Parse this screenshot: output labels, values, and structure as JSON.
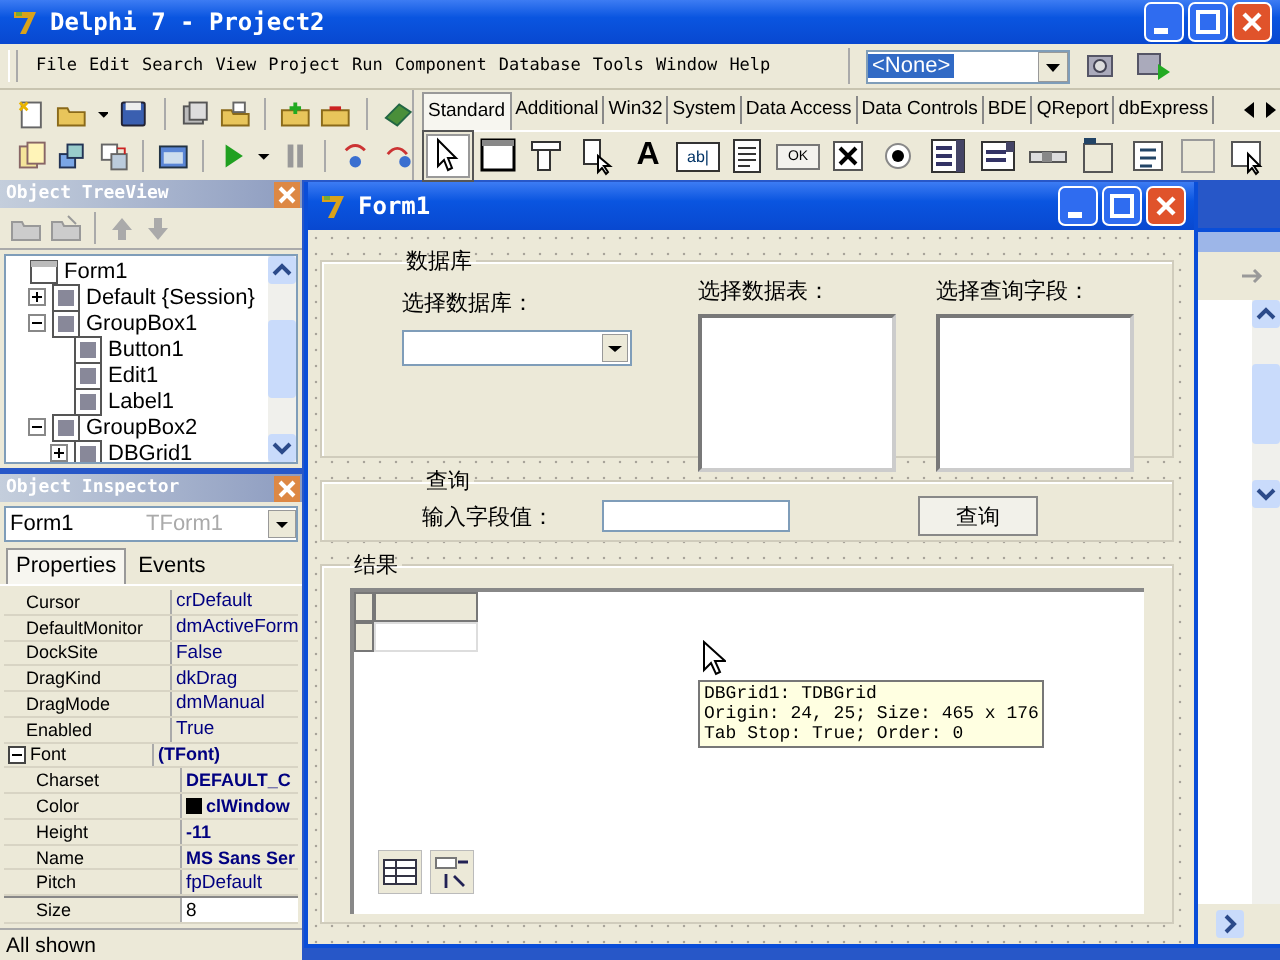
{
  "main_window": {
    "title": "Delphi 7 - Project2"
  },
  "menu": [
    "File",
    "Edit",
    "Search",
    "View",
    "Project",
    "Run",
    "Component",
    "Database",
    "Tools",
    "Window",
    "Help"
  ],
  "component_combo": {
    "value": "<None>"
  },
  "palette_tabs": [
    {
      "label": "Standard",
      "selected": true
    },
    {
      "label": "Additional",
      "selected": false
    },
    {
      "label": "Win32",
      "selected": false
    },
    {
      "label": "System",
      "selected": false
    },
    {
      "label": "Data Access",
      "selected": false
    },
    {
      "label": "Data Controls",
      "selected": false
    },
    {
      "label": "BDE",
      "selected": false
    },
    {
      "label": "QReport",
      "selected": false
    },
    {
      "label": "dbExpress",
      "selected": false
    }
  ],
  "palette_items": [
    {
      "kind": "pointer",
      "selected": true
    },
    {
      "kind": "frame",
      "selected": false
    },
    {
      "kind": "mainmenu",
      "selected": false
    },
    {
      "kind": "popupmenu",
      "selected": false
    },
    {
      "kind": "label",
      "glyph": "A",
      "selected": false
    },
    {
      "kind": "edit",
      "glyph": "ab|",
      "selected": false
    },
    {
      "kind": "memo",
      "selected": false
    },
    {
      "kind": "button",
      "glyph": "OK",
      "selected": false
    },
    {
      "kind": "checkbox",
      "selected": false
    },
    {
      "kind": "radio",
      "selected": false
    },
    {
      "kind": "listbox",
      "selected": false
    },
    {
      "kind": "combobox",
      "selected": false
    },
    {
      "kind": "scrollbar",
      "selected": false
    },
    {
      "kind": "groupbox",
      "selected": false
    },
    {
      "kind": "radiogroup",
      "selected": false
    },
    {
      "kind": "panel",
      "selected": false
    },
    {
      "kind": "actionlist",
      "selected": false
    }
  ],
  "tree_view": {
    "title": "Object TreeView",
    "items": [
      {
        "label": "Form1",
        "children": [
          {
            "label": "Default {Session}",
            "expanded": false
          },
          {
            "label": "GroupBox1",
            "expanded": true,
            "children": [
              {
                "label": "Button1"
              },
              {
                "label": "Edit1"
              },
              {
                "label": "Label1"
              }
            ]
          },
          {
            "label": "GroupBox2",
            "expanded": true,
            "children": [
              {
                "label": "DBGrid1",
                "expanded": false
              }
            ]
          }
        ]
      }
    ]
  },
  "object_inspector": {
    "title": "Object Inspector",
    "object": "Form1",
    "object_type": "TForm1",
    "tabs": [
      {
        "label": "Properties",
        "selected": true
      },
      {
        "label": "Events",
        "selected": false
      }
    ],
    "properties": [
      {
        "name": "Cursor",
        "value": "crDefault",
        "modified": false,
        "selected": false
      },
      {
        "name": "DefaultMonitor",
        "value": "dmActiveForm",
        "modified": false,
        "selected": false
      },
      {
        "name": "DockSite",
        "value": "False",
        "modified": false,
        "selected": false
      },
      {
        "name": "DragKind",
        "value": "dkDrag",
        "modified": false,
        "selected": false
      },
      {
        "name": "DragMode",
        "value": "dmManual",
        "modified": false,
        "selected": false
      },
      {
        "name": "Enabled",
        "value": "True",
        "modified": false,
        "selected": false
      },
      {
        "name": "Font",
        "value": "(TFont)",
        "modified": true,
        "selected": false,
        "expanded": true,
        "children": [
          {
            "name": "Charset",
            "value": "DEFAULT_C",
            "modified": true,
            "selected": false
          },
          {
            "name": "Color",
            "value": "clWindow",
            "modified": true,
            "selected": false,
            "color": "#000000"
          },
          {
            "name": "Height",
            "value": "-11",
            "modified": true,
            "selected": false
          },
          {
            "name": "Name",
            "value": "MS Sans Ser",
            "modified": true,
            "selected": false
          },
          {
            "name": "Pitch",
            "value": "fpDefault",
            "modified": false,
            "selected": false
          },
          {
            "name": "Size",
            "value": "8",
            "modified": false,
            "selected": true
          }
        ]
      }
    ],
    "status": "All shown"
  },
  "form": {
    "title": "Form1",
    "database_group": {
      "caption": "数据库",
      "database_label": "选择数据库：",
      "table_label": "选择数据表：",
      "field_label": "选择查询字段："
    },
    "query_group": {
      "caption": "查询",
      "input_label": "输入字段值：",
      "button": "查询"
    },
    "result_group": {
      "caption": "结果",
      "tooltip": [
        "DBGrid1: TDBGrid",
        "Origin: 24, 25; Size: 465 x 176",
        "Tab Stop: True; Order: 0"
      ]
    }
  }
}
